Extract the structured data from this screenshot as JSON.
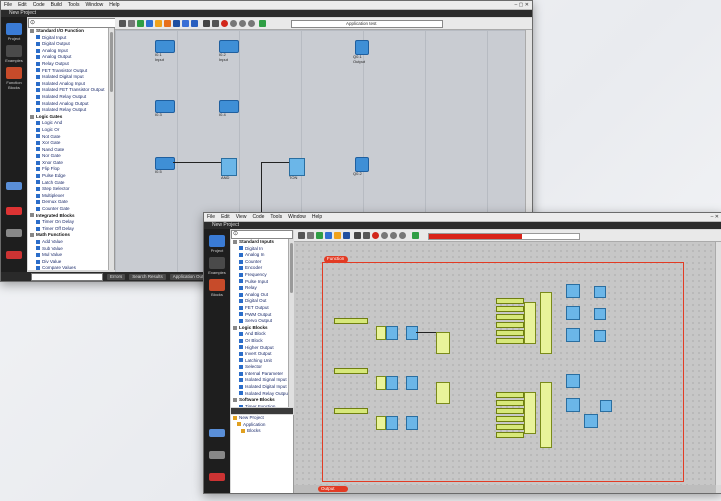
{
  "window1": {
    "menu": [
      "File",
      "Edit",
      "Code",
      "Build",
      "Tools",
      "Window",
      "Help"
    ],
    "tab": "New Project",
    "toolbar_field": "Application test",
    "left_tools": [
      "Project",
      "Examples",
      "Function Blocks",
      "Variables"
    ],
    "tree": [
      {
        "label": "Standard I/O Function",
        "group": true
      },
      {
        "label": "Digital Input"
      },
      {
        "label": "Digital Output"
      },
      {
        "label": "Analog Input"
      },
      {
        "label": "Analog Output"
      },
      {
        "label": "Relay Output"
      },
      {
        "label": "FET Transistor Output"
      },
      {
        "label": "Isolated Digital Input"
      },
      {
        "label": "Isolated Analog Input"
      },
      {
        "label": "Isolated FET Transistor Output"
      },
      {
        "label": "Isolated Relay Output"
      },
      {
        "label": "Isolated Analog Output"
      },
      {
        "label": "Isolated Relay Output"
      },
      {
        "label": "Logic Gates",
        "group": true
      },
      {
        "label": "Logic And"
      },
      {
        "label": "Logic Or"
      },
      {
        "label": "Not Gate"
      },
      {
        "label": "Xor Gate"
      },
      {
        "label": "Nand Gate"
      },
      {
        "label": "Nor Gate"
      },
      {
        "label": "Xnor Gate"
      },
      {
        "label": "Flip Flop"
      },
      {
        "label": "Pulse Edge"
      },
      {
        "label": "Latch Gate"
      },
      {
        "label": "Step Selector"
      },
      {
        "label": "Multiplexer"
      },
      {
        "label": "Demux Gate"
      },
      {
        "label": "Counter Gate"
      },
      {
        "label": "Integrated Blocks",
        "group": true
      },
      {
        "label": "Timer On Delay"
      },
      {
        "label": "Timer Off Delay"
      },
      {
        "label": "Math Functions",
        "group": true
      },
      {
        "label": "Add Value"
      },
      {
        "label": "Sub Value"
      },
      {
        "label": "Mul Value"
      },
      {
        "label": "Div Value"
      },
      {
        "label": "Compare Values"
      },
      {
        "label": "Timer Control Setup"
      },
      {
        "label": "System Parameters"
      },
      {
        "label": "Set Parameter"
      },
      {
        "label": "Bit Manipulation",
        "group": true
      },
      {
        "label": "Write Parameter"
      }
    ],
    "status": [
      "Errors",
      "Search Results",
      "Application Output"
    ],
    "blocks": [
      {
        "id": "I0.1",
        "sub": "Input"
      },
      {
        "id": "I0.2",
        "sub": "Input"
      },
      {
        "id": "Q0.1",
        "sub": "Output"
      },
      {
        "id": "I0.3",
        "sub": "Input"
      },
      {
        "id": "I0.4",
        "sub": "Input"
      },
      {
        "id": "I0.5",
        "sub": "Input"
      },
      {
        "id": "AND",
        "sub": "Gate"
      },
      {
        "id": "TON",
        "sub": "Timer"
      },
      {
        "id": "Q0.2",
        "sub": "Output"
      }
    ]
  },
  "window2": {
    "menu": [
      "File",
      "Edit",
      "View",
      "Code",
      "Tools",
      "Window",
      "Help"
    ],
    "tab": "New Project",
    "progress": 0.62,
    "tree": [
      {
        "label": "Standard Inputs",
        "group": true
      },
      {
        "label": "Digital In"
      },
      {
        "label": "Analog In"
      },
      {
        "label": "Counter"
      },
      {
        "label": "Encoder"
      },
      {
        "label": "Frequency"
      },
      {
        "label": "Pulse Input"
      },
      {
        "label": "Relay"
      },
      {
        "label": "Analog Out"
      },
      {
        "label": "Digital Out"
      },
      {
        "label": "FET Output"
      },
      {
        "label": "PWM Output"
      },
      {
        "label": "Servo Output"
      },
      {
        "label": "Logic Blocks",
        "group": true
      },
      {
        "label": "And Block"
      },
      {
        "label": "Or Block"
      },
      {
        "label": "Higher Output"
      },
      {
        "label": "Invert Output"
      },
      {
        "label": "Latching Unit"
      },
      {
        "label": "Selector"
      },
      {
        "label": "Internal Parameter"
      },
      {
        "label": "Isolated Signal Input"
      },
      {
        "label": "Isolated Digital Input"
      },
      {
        "label": "Isolated Relay Output"
      },
      {
        "label": "Software Blocks",
        "group": true
      },
      {
        "label": "Timer Function"
      },
      {
        "label": "Compare Value"
      },
      {
        "label": "Counting Mode"
      },
      {
        "label": "Storage Parameter"
      }
    ],
    "project_tree": [
      "New Project",
      "Application",
      "Blocks"
    ],
    "left_tools": [
      "Project",
      "Examples",
      "Blocks",
      "Variables"
    ],
    "frame_tag": "Function",
    "status_tag": "Output"
  }
}
